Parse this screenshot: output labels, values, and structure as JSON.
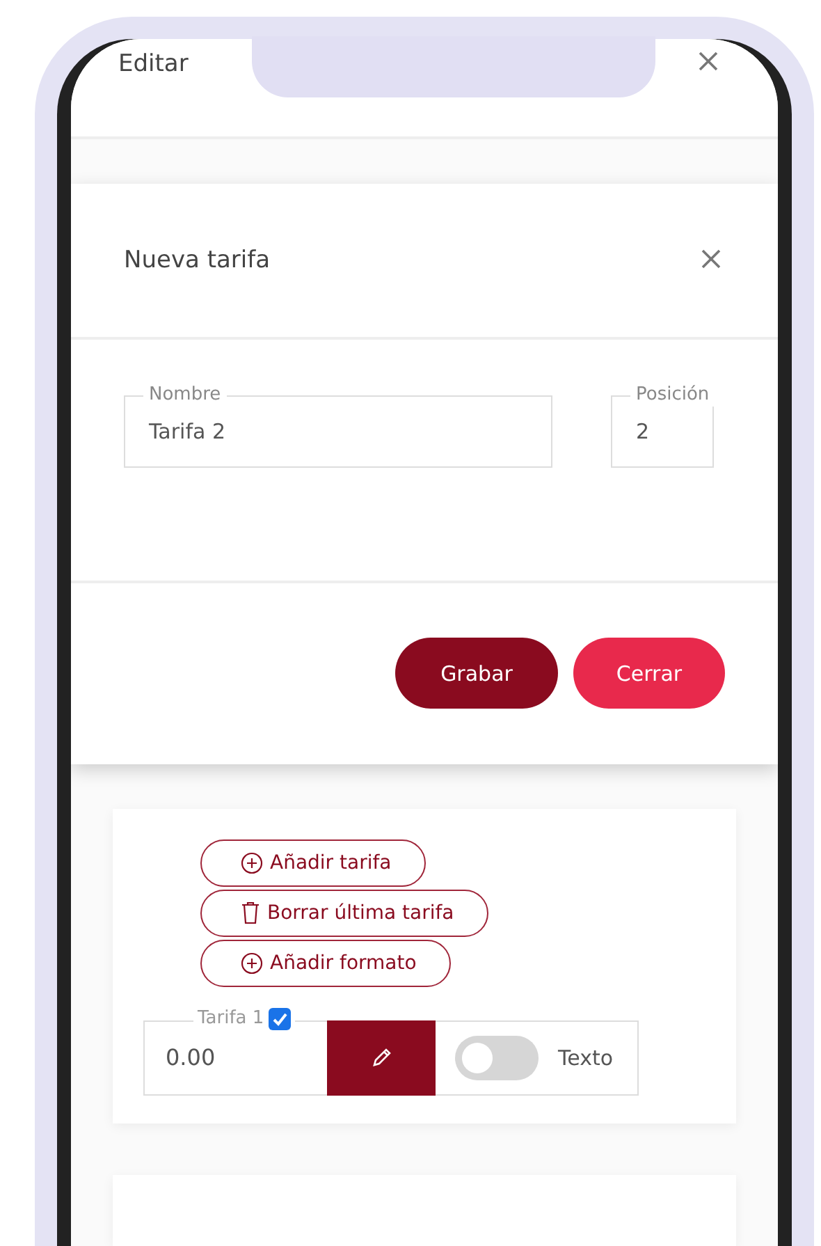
{
  "background_page": {
    "title": "Editar"
  },
  "dialog": {
    "title": "Nueva tarifa",
    "fields": [
      {
        "label": "Nombre",
        "value": "Tarifa 2"
      },
      {
        "label": "Posición",
        "value": "2"
      }
    ],
    "buttons": [
      {
        "label": "Grabar",
        "kind": "primary"
      },
      {
        "label": "Cerrar",
        "kind": "secondary"
      }
    ]
  },
  "actions": [
    {
      "label": "Añadir tarifa",
      "kind": "add"
    },
    {
      "label": "Borrar última tarifa",
      "kind": "delete"
    },
    {
      "label": "Añadir formato",
      "kind": "add"
    }
  ],
  "tariff_row": {
    "label": "Tarifa 1",
    "checked": true,
    "value": "0.00",
    "toggle_label": "Texto",
    "on": false
  }
}
